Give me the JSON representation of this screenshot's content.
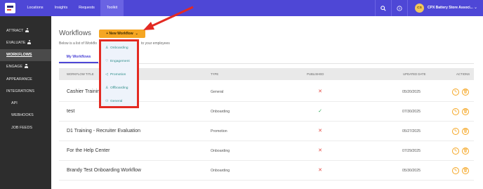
{
  "topbar": {
    "logo": "company-logo",
    "nav": [
      {
        "label": "Locations",
        "active": false
      },
      {
        "label": "Insights",
        "active": false
      },
      {
        "label": "Requests",
        "active": false
      },
      {
        "label": "Toolkit",
        "active": true
      }
    ],
    "icons": [
      "search-icon",
      "help-icon"
    ],
    "store": {
      "initials": "CS",
      "name": "CPX Battery Store Associ...",
      "chevron": "chevron-down-icon"
    }
  },
  "sidebar": {
    "items": [
      {
        "label": "ATTRACT",
        "icon": "person-icon"
      },
      {
        "label": "EVALUATE",
        "icon": "person-icon"
      },
      {
        "label": "WORKFLOWS",
        "active": true
      },
      {
        "label": "ENGAGE",
        "icon": "person-icon"
      },
      {
        "label": "APPEARANCE"
      },
      {
        "label": "INTEGRATIONS"
      },
      {
        "label": "API",
        "sub": true
      },
      {
        "label": "WEBHOOKS",
        "sub": true
      },
      {
        "label": "JOB FEEDS",
        "sub": true
      }
    ]
  },
  "main": {
    "title": "Workflows",
    "new_button": "+ New Workflow",
    "subtitle_left": "Below is a list of Workflo",
    "subtitle_right": "to your employees",
    "tab": "My Workflows",
    "columns": {
      "title": "WORKFLOW TITLE",
      "type": "TYPE",
      "published": "PUBLISHED",
      "updated": "UPDATED DATE",
      "actions": "ACTIONS"
    },
    "rows": [
      {
        "title": "Cashier Training",
        "type": "General",
        "published": false,
        "updated": "05/20/2025"
      },
      {
        "title": "test",
        "type": "Onboarding",
        "published": true,
        "updated": "07/30/2025"
      },
      {
        "title": "D1 Training - Recruiter Evaluation",
        "type": "Promotion",
        "published": false,
        "updated": "05/27/2025"
      },
      {
        "title": "For the Help Center",
        "type": "Onboarding",
        "published": false,
        "updated": "07/29/2025"
      },
      {
        "title": "Brandy Test Onboarding Workflow",
        "type": "Onboarding",
        "published": false,
        "updated": "05/30/2025"
      }
    ],
    "published_icons": {
      "no": "✕",
      "yes": "✓"
    }
  },
  "dropdown": {
    "items": [
      {
        "label": "Onboarding",
        "icon": "person-icon"
      },
      {
        "label": "Engagement",
        "icon": "heart-icon"
      },
      {
        "label": "Promotion",
        "icon": "megaphone-icon"
      },
      {
        "label": "Offboarding",
        "icon": "person-exit-icon"
      },
      {
        "label": "General",
        "icon": "group-icon"
      }
    ]
  },
  "colors": {
    "topbar": "#4e47d6",
    "sidebar": "#2d2d2d",
    "accent": "#f5a623",
    "highlight": "#e32a22",
    "dropdown_text": "#2f8f8a"
  }
}
